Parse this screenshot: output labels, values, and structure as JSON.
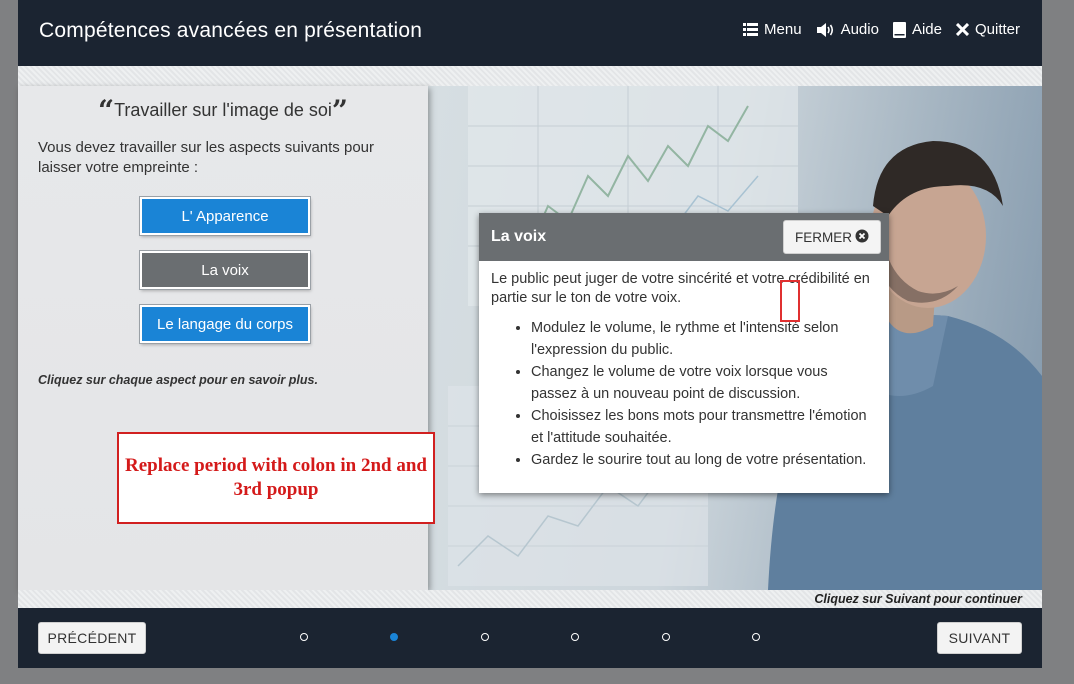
{
  "header": {
    "title": "Compétences avancées en présentation",
    "nav": [
      {
        "icon": "menu-icon",
        "label": "Menu"
      },
      {
        "icon": "audio-icon",
        "label": "Audio"
      },
      {
        "icon": "book-icon",
        "label": "Aide"
      },
      {
        "icon": "close-x-icon",
        "label": "Quitter"
      }
    ]
  },
  "left_panel": {
    "title": "Travailler sur l'image de soi",
    "intro": "Vous devez travailler sur les aspects suivants pour laisser votre empreinte :",
    "buttons": [
      "L' Apparence",
      "La voix",
      "Le langage du corps"
    ],
    "hint": "Cliquez sur chaque aspect pour en savoir plus."
  },
  "popup": {
    "title": "La voix",
    "close_label": "FERMER",
    "text": "Le public peut juger de votre sincérité et votre crédibilité en partie sur le ton de votre voix.",
    "bullets": [
      "Modulez le volume, le rythme et l'intensité selon l'expression du public.",
      "Changez le volume de votre voix lorsque vous passez à un nouveau point de discussion.",
      "Choisissez les bons mots pour transmettre l'émotion et l'attitude souhaitée.",
      "Gardez le sourire tout au long de votre présentation."
    ]
  },
  "annotation": {
    "note": "Replace period with colon in 2nd and 3rd popup"
  },
  "footer": {
    "continue_hint": "Cliquez sur Suivant pour continuer",
    "prev_label": "PRÉCÉDENT",
    "next_label": "SUIVANT",
    "current_page": 2,
    "total_pages": 6
  },
  "colors": {
    "bar": "#1b2431",
    "accent_blue": "#1a84d6",
    "selected_gray": "#6a6e71",
    "annotation_red": "#d12020"
  }
}
